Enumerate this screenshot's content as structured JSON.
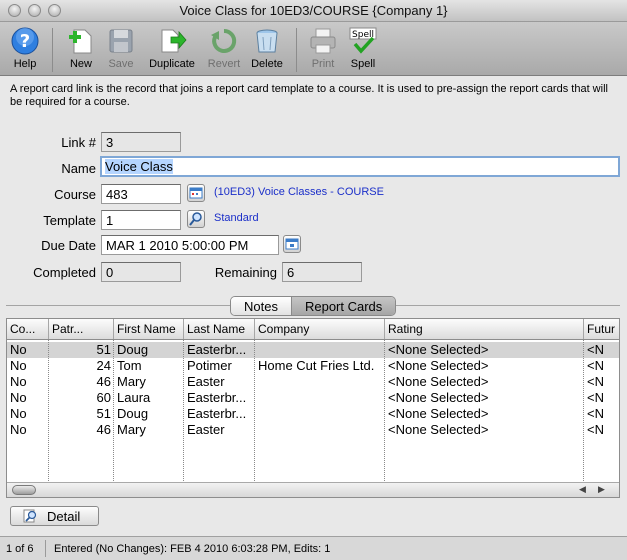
{
  "window": {
    "title": "Voice Class for 10ED3/COURSE {Company 1}"
  },
  "toolbar": {
    "help": "Help",
    "new": "New",
    "save": "Save",
    "duplicate": "Duplicate",
    "revert": "Revert",
    "delete": "Delete",
    "print": "Print",
    "spell": "Spell",
    "spell_badge": "Spell"
  },
  "description": "A report card link is the record that joins a report card template to a course.  It is used to pre-assign the report cards that will be required for a course.",
  "form": {
    "link_label": "Link #",
    "link_value": "3",
    "name_label": "Name",
    "name_value": "Voice Class",
    "course_label": "Course",
    "course_value": "483",
    "course_link": "(10ED3) Voice Classes - COURSE",
    "template_label": "Template",
    "template_value": "1",
    "template_link": "Standard",
    "due_label": "Due Date",
    "due_value": "MAR 1 2010 5:00:00 PM",
    "completed_label": "Completed",
    "completed_value": "0",
    "remaining_label": "Remaining",
    "remaining_value": "6"
  },
  "tabs": {
    "notes": "Notes",
    "report_cards": "Report Cards"
  },
  "table": {
    "columns": [
      "Co...",
      "Patr...",
      "First Name",
      "Last Name",
      "Company",
      "Rating",
      "Futur"
    ],
    "rows": [
      [
        "No",
        "51",
        "Doug",
        "Easterbr...",
        "",
        "<None Selected>",
        "<N"
      ],
      [
        "No",
        "24",
        "Tom",
        "Potimer",
        "Home Cut Fries Ltd.",
        "<None Selected>",
        "<N"
      ],
      [
        "No",
        "46",
        "Mary",
        "Easter",
        "",
        "<None Selected>",
        "<N"
      ],
      [
        "No",
        "60",
        "Laura",
        "Easterbr...",
        "",
        "<None Selected>",
        "<N"
      ],
      [
        "No",
        "51",
        "Doug",
        "Easterbr...",
        "",
        "<None Selected>",
        "<N"
      ],
      [
        "No",
        "46",
        "Mary",
        "Easter",
        "",
        "<None Selected>",
        "<N"
      ]
    ],
    "selected_row": 0
  },
  "detail_button": "Detail",
  "status": {
    "record": "1 of 6",
    "info": "Entered (No Changes): FEB 4 2010 6:03:28 PM, Edits: 1"
  },
  "colors": {
    "link": "#1b2fc9",
    "selection": "#b5d5ff",
    "selected_row": "#d4d4d4"
  },
  "icons": [
    "help-icon",
    "new-icon",
    "save-icon",
    "duplicate-icon",
    "revert-icon",
    "delete-icon",
    "print-icon",
    "spell-icon",
    "calendar-icon",
    "magnifier-icon"
  ]
}
